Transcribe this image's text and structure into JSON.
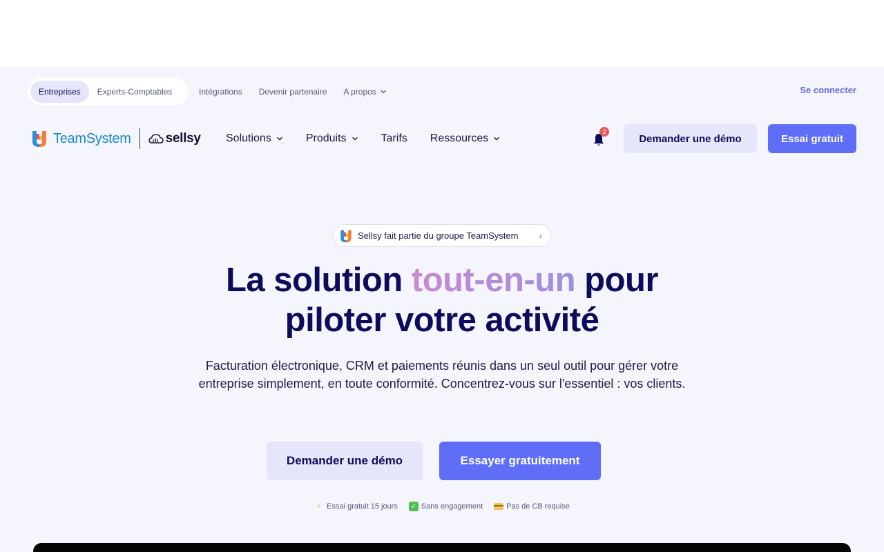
{
  "audience": {
    "tabs": [
      {
        "label": "Entreprises",
        "active": true
      },
      {
        "label": "Experts-Comptables",
        "active": false
      }
    ]
  },
  "top_links": {
    "integrations": "Intégrations",
    "partner": "Devenir partenaire",
    "about": "A propos",
    "login": "Se connecter"
  },
  "brand": {
    "teamsystem": "TeamSystem",
    "sellsy": "sellsy"
  },
  "nav": {
    "solutions": "Solutions",
    "products": "Produits",
    "pricing": "Tarifs",
    "resources": "Ressources"
  },
  "notifications": {
    "count": "2"
  },
  "header_buttons": {
    "demo": "Demander une démo",
    "trial": "Essai gratuit"
  },
  "hero": {
    "group_pill": "Sellsy fait partie du groupe TeamSystem",
    "title_part1": "La solution ",
    "title_highlight": "tout-en-un",
    "title_part2": " pour",
    "title_line2": "piloter votre activité",
    "subtitle": "Facturation électronique, CRM et paiements réunis dans un seul outil pour gérer votre entreprise simplement, en toute conformité. Concentrez-vous sur l'essentiel : vos clients.",
    "demo_button": "Demander une démo",
    "trial_button": "Essayer gratuitement"
  },
  "perks": [
    {
      "icon": "lightning-icon",
      "label": "Essai gratuit 15 jours"
    },
    {
      "icon": "check-icon",
      "label": "Sans engagement"
    },
    {
      "icon": "credit-card-icon",
      "label": "Pas de CB requise"
    }
  ],
  "colors": {
    "navy": "#0d0b5c",
    "accent": "#5f6df7",
    "soft_accent": "#e6e6fb",
    "page_bg": "#f5f6fd",
    "teamsystem_blue": "#1b87c9",
    "highlight_gradient": "#c98ad2"
  }
}
